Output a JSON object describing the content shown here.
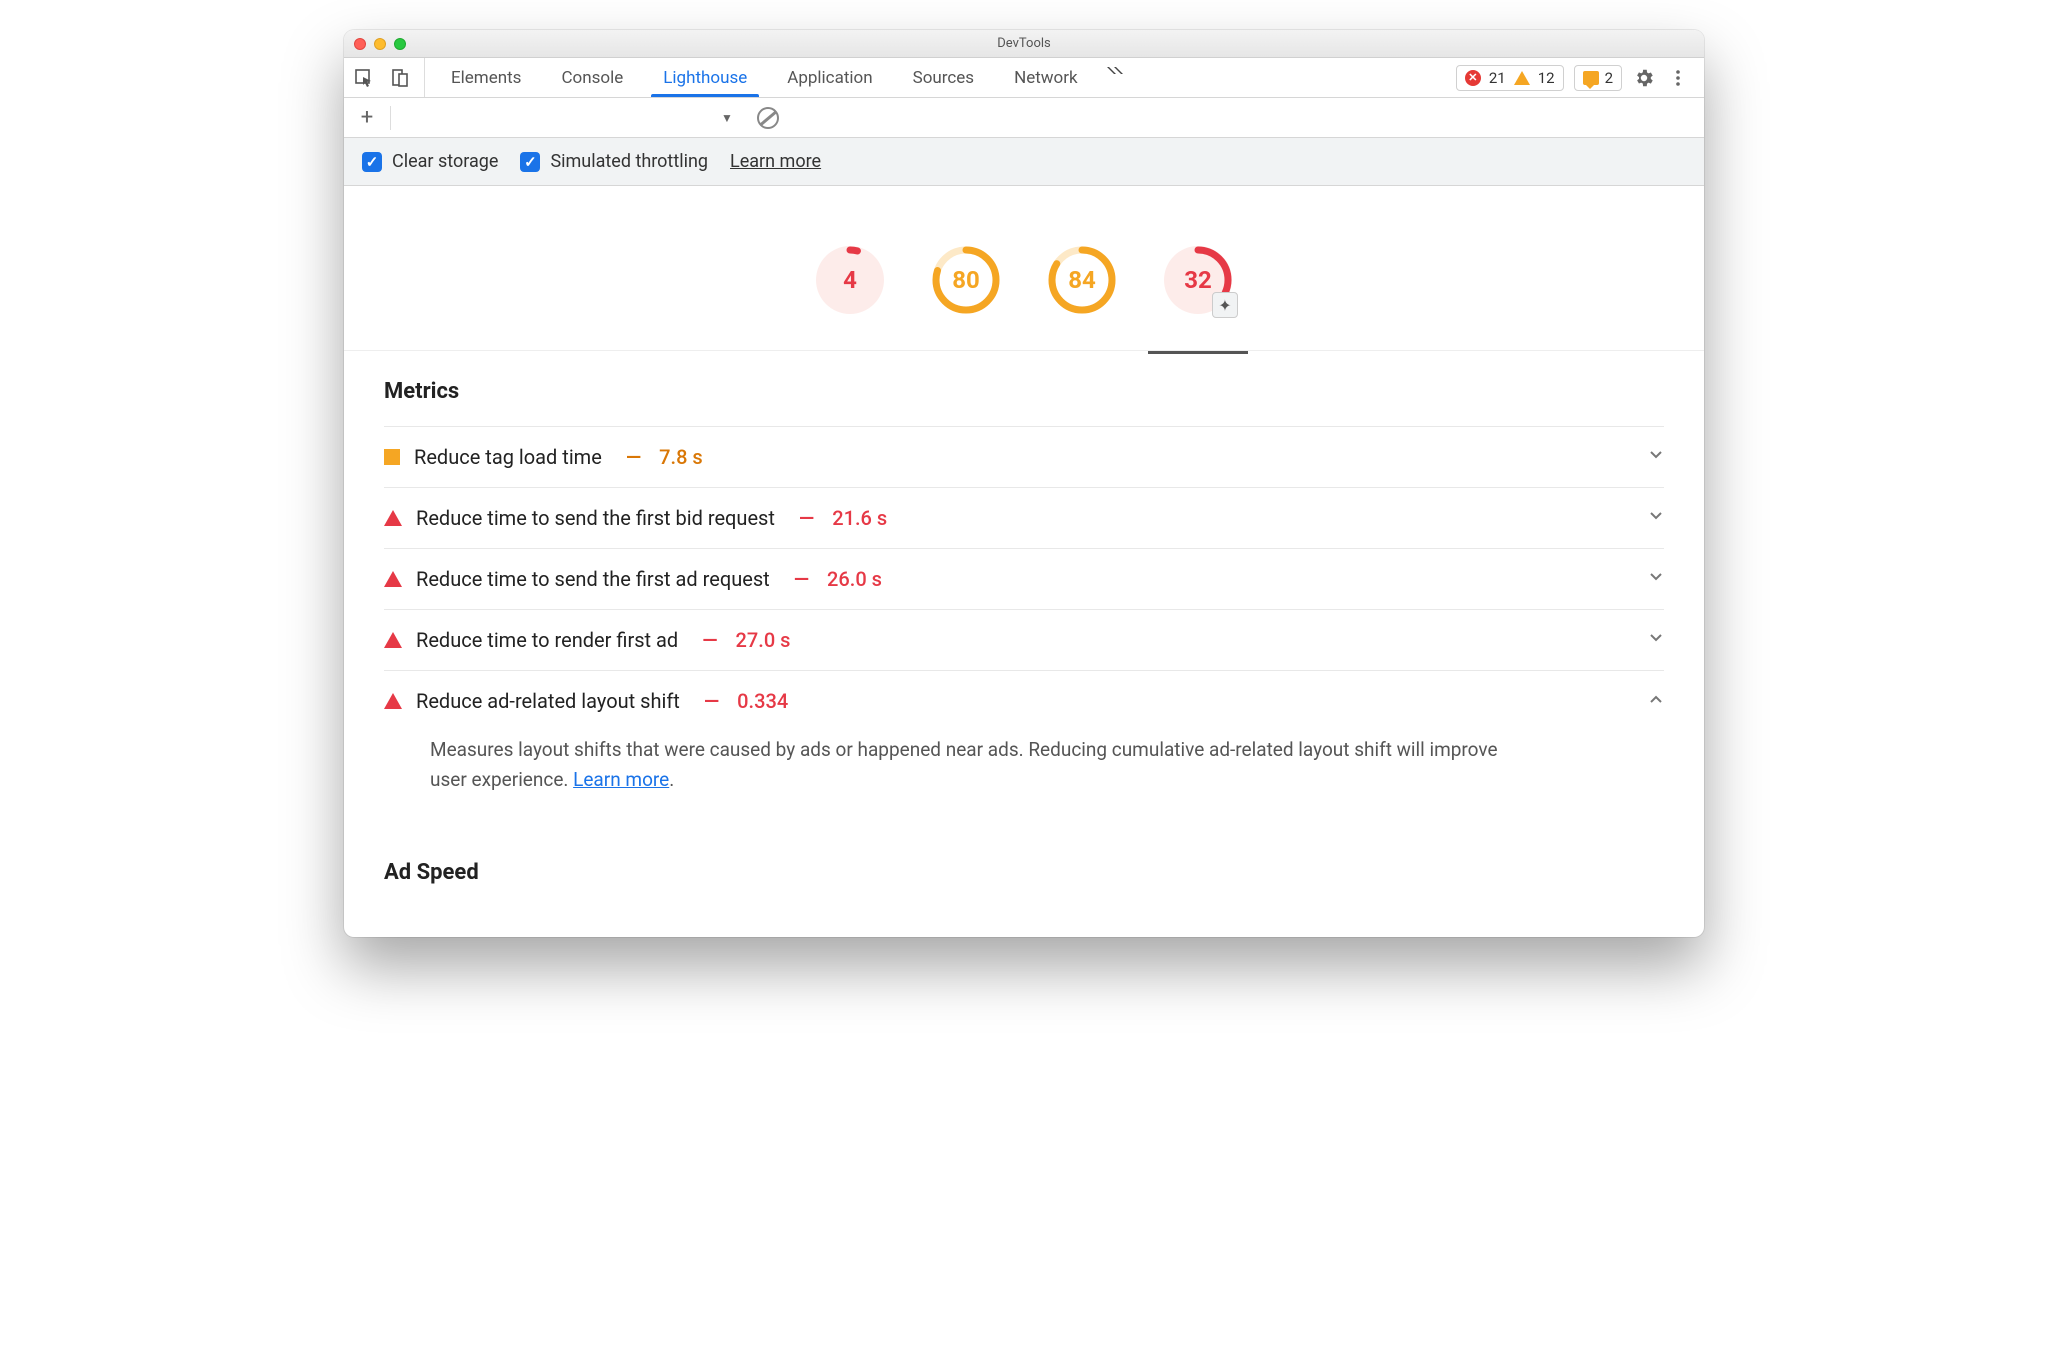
{
  "window": {
    "title": "DevTools"
  },
  "tabs": {
    "items": [
      "Elements",
      "Console",
      "Lighthouse",
      "Application",
      "Sources",
      "Network"
    ],
    "active": "Lighthouse"
  },
  "badges": {
    "errors": "21",
    "warnings": "12",
    "messages": "2"
  },
  "options": {
    "clear_storage": "Clear storage",
    "simulated_throttling": "Simulated throttling",
    "learn_more": "Learn more"
  },
  "gauges": [
    {
      "score": 4,
      "status": "red"
    },
    {
      "score": 80,
      "status": "orange"
    },
    {
      "score": 84,
      "status": "orange"
    },
    {
      "score": 32,
      "status": "red",
      "plugin": true,
      "selected": true
    }
  ],
  "sections": {
    "metrics_title": "Metrics",
    "ad_speed_title": "Ad Speed"
  },
  "metrics": [
    {
      "icon": "square",
      "label": "Reduce tag load time",
      "value": "7.8 s",
      "tone": "orange",
      "expanded": false
    },
    {
      "icon": "triangle",
      "label": "Reduce time to send the first bid request",
      "value": "21.6 s",
      "tone": "red",
      "expanded": false
    },
    {
      "icon": "triangle",
      "label": "Reduce time to send the first ad request",
      "value": "26.0 s",
      "tone": "red",
      "expanded": false
    },
    {
      "icon": "triangle",
      "label": "Reduce time to render first ad",
      "value": "27.0 s",
      "tone": "red",
      "expanded": false
    },
    {
      "icon": "triangle",
      "label": "Reduce ad-related layout shift",
      "value": "0.334",
      "tone": "red",
      "expanded": true,
      "description": "Measures layout shifts that were caused by ads or happened near ads. Reducing cumulative ad-related layout shift will improve user experience. ",
      "description_link": "Learn more"
    }
  ],
  "colors": {
    "red": "#e63946",
    "orange": "#f5a623",
    "blue": "#1a73e8"
  }
}
